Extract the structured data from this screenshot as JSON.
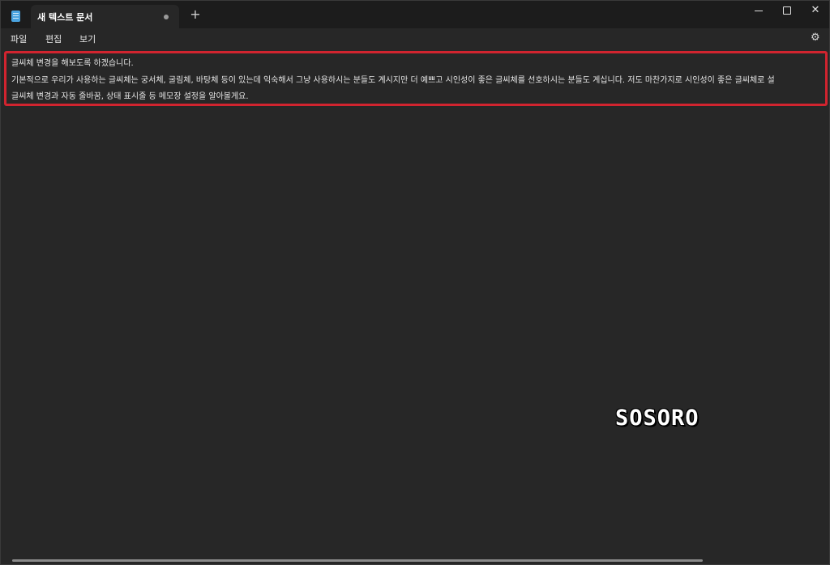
{
  "window": {
    "tab_title": "새 텍스트 문서",
    "new_tab_glyph": "+",
    "close_glyph": "✕"
  },
  "menu": {
    "file": "파일",
    "edit": "편집",
    "view": "보기",
    "settings_glyph": "⚙"
  },
  "editor": {
    "lines": [
      "글씨체 변경을 해보도록 하겠습니다.",
      "기본적으로 우리가 사용하는 글씨체는 궁서체, 굴림체, 바탕체 등이 있는데 익숙해서 그냥 사용하시는 분들도 계시지만 더 예쁘고 시인성이 좋은 글씨체를 선호하시는 분들도 계십니다. 저도 마찬가지로 시인성이 좋은 글씨체로 설",
      "글씨체 변경과 자동 줄바꿈, 상태 표시줄 등 메모장 설정을 알아볼게요."
    ]
  },
  "watermark": {
    "text": "SOSORO"
  },
  "colors": {
    "highlight_border": "#d1242f",
    "background": "#272727",
    "titlebar": "#1c1c1c"
  },
  "icons": {
    "app": "notepad-icon",
    "settings": "gear-icon"
  }
}
